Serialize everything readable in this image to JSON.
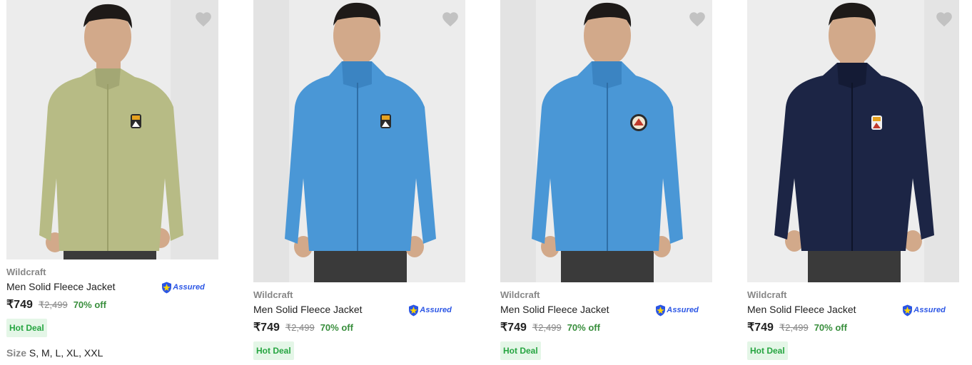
{
  "products": [
    {
      "brand": "Wildcraft",
      "title": "Men Solid Fleece Jacket",
      "assured": "Assured",
      "price": "₹749",
      "mrp": "₹2,499",
      "discount": "70% off",
      "deal": "Hot Deal",
      "size_label": "Size",
      "sizes": "S, M, L, XL, XXL",
      "jacket_color": "#b7bb85",
      "jacket_shade": "#a3a774",
      "patch": "mountain-patch-icon"
    },
    {
      "brand": "Wildcraft",
      "title": "Men Solid Fleece Jacket",
      "assured": "Assured",
      "price": "₹749",
      "mrp": "₹2,499",
      "discount": "70% off",
      "deal": "Hot Deal",
      "jacket_color": "#4a97d6",
      "jacket_shade": "#3b84c2",
      "patch": "mountain-patch-icon"
    },
    {
      "brand": "Wildcraft",
      "title": "Men Solid Fleece Jacket",
      "assured": "Assured",
      "price": "₹749",
      "mrp": "₹2,499",
      "discount": "70% off",
      "deal": "Hot Deal",
      "jacket_color": "#4a97d6",
      "jacket_shade": "#3b84c2",
      "patch": "round-badge-icon"
    },
    {
      "brand": "Wildcraft",
      "title": "Men Solid Fleece Jacket",
      "assured": "Assured",
      "price": "₹749",
      "mrp": "₹2,499",
      "discount": "70% off",
      "deal": "Hot Deal",
      "jacket_color": "#1c2545",
      "jacket_shade": "#141b35",
      "patch": "mountain-patch-icon"
    }
  ],
  "colors": {
    "background": "#efefef",
    "wishlist": "#c2c2c2",
    "brand_text": "#878787",
    "discount": "#388e3c",
    "deal_bg": "#e4f6e7",
    "deal_text": "#26a541",
    "assured_blue": "#2a55e5",
    "skin": "#d2a98a",
    "hair": "#1e1a18",
    "pants": "#3a3a3a"
  },
  "icons": {
    "wishlist": "heart-icon",
    "assured": "assured-shield-icon"
  }
}
